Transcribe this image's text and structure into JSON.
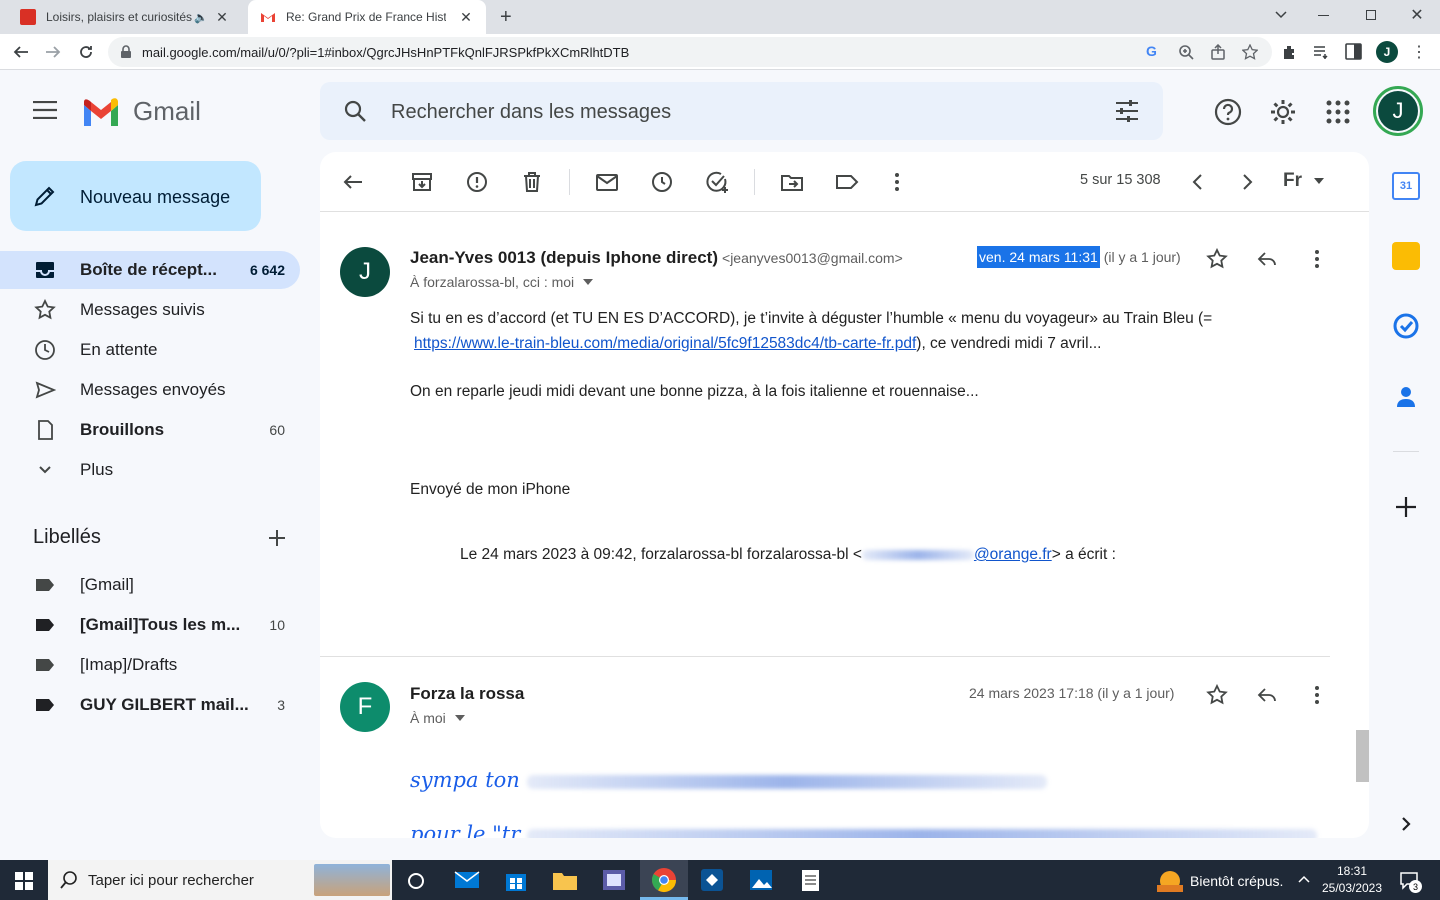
{
  "browser": {
    "tabs": [
      {
        "title": "Loisirs, plaisirs et curiosités :",
        "active": false
      },
      {
        "title": "Re: Grand Prix de France Historiq",
        "active": true
      }
    ],
    "new_tab": "+",
    "url": "mail.google.com/mail/u/0/?pli=1#inbox/QgrcJHsHnPTFkQnlFJRSPkfPkXCmRlhtDTB",
    "profile_initial": "J"
  },
  "gmail": {
    "logo_text": "Gmail",
    "search_placeholder": "Rechercher dans les messages",
    "account_initial": "J",
    "compose_label": "Nouveau message",
    "nav": [
      {
        "label": "Boîte de récept...",
        "count": "6 642",
        "icon": "inbox-icon",
        "bold": true,
        "active": true
      },
      {
        "label": "Messages suivis",
        "count": "",
        "icon": "star-icon",
        "bold": false,
        "active": false
      },
      {
        "label": "En attente",
        "count": "",
        "icon": "clock-icon",
        "bold": false,
        "active": false
      },
      {
        "label": "Messages envoyés",
        "count": "",
        "icon": "send-icon",
        "bold": false,
        "active": false
      },
      {
        "label": "Brouillons",
        "count": "60",
        "icon": "draft-icon",
        "bold": true,
        "active": false
      },
      {
        "label": "Plus",
        "count": "",
        "icon": "chevron-down-icon",
        "bold": false,
        "active": false
      }
    ],
    "labels_heading": "Libellés",
    "labels": [
      {
        "label": "[Gmail]",
        "count": "",
        "bold": false
      },
      {
        "label": "[Gmail]Tous les m...",
        "count": "10",
        "bold": true
      },
      {
        "label": "[Imap]/Drafts",
        "count": "",
        "bold": false
      },
      {
        "label": "GUY GILBERT mail...",
        "count": "3",
        "bold": true
      }
    ],
    "pagination": "5 sur 15 308",
    "lang_btn": "Fr",
    "messages": [
      {
        "avatar_letter": "J",
        "avatar_color": "#0b4a3e",
        "sender": "Jean-Yves 0013 (depuis Iphone direct)",
        "sender_email": "<jeanyves0013@gmail.com>",
        "recipients": "À forzalarossa-bl, cci : moi",
        "date_highlight": "ven. 24 mars 11:31",
        "date_relative": "(il y a 1 jour)",
        "body_line1": "Si tu en es d’accord (et TU EN ES D’ACCORD), je t’invite à déguster l’humble « menu du voyageur» au Train Bleu (=",
        "body_link": "https://www.le-train-bleu.com/media/original/5fc9f12583dc4/tb-carte-fr.pdf",
        "body_line2_tail": "), ce vendredi midi 7 avril...",
        "body_para2": "On en reparle jeudi midi devant une bonne pizza, à la fois italienne et rouennaise...",
        "signature": "Envoyé de mon iPhone",
        "quote_prefix": "Le 24 mars 2023 à 09:42, forzalarossa-bl forzalarossa-bl <",
        "quote_email_domain": "@orange.fr",
        "quote_suffix": "> a écrit :"
      },
      {
        "avatar_letter": "F",
        "avatar_color": "#0d8c6c",
        "sender": "Forza la rossa",
        "recipients": "À moi",
        "date": "24 mars 2023 17:18 (il y a 1 jour)",
        "body_line1": "sympa ton",
        "body_line2": "pour le \"tr"
      }
    ]
  },
  "taskbar": {
    "search_placeholder": "Taper ici pour rechercher",
    "weather": "Bientôt crépus.",
    "time": "18:31",
    "date": "25/03/2023",
    "notifications": "3"
  },
  "side_panel": {
    "calendar_day": "31"
  }
}
